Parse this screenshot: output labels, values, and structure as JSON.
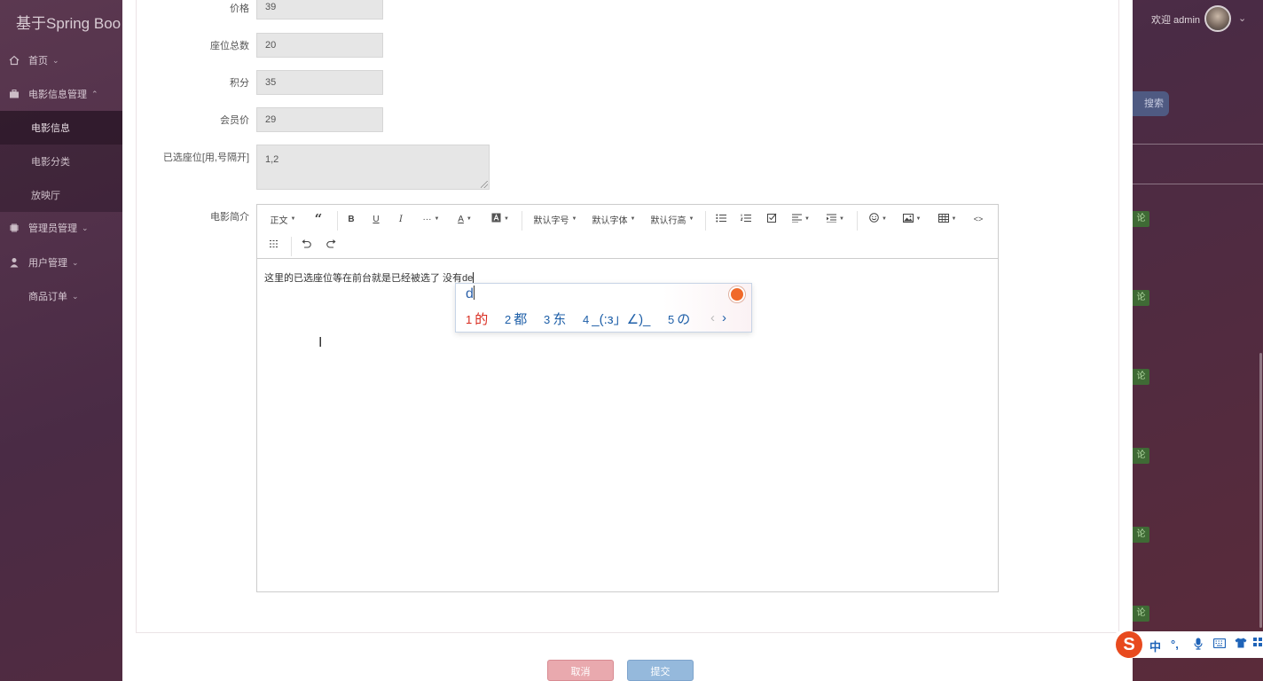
{
  "app": {
    "title": "基于Spring Boo",
    "welcome": "欢迎 admin",
    "user_chevron": "⌄"
  },
  "sidebar": {
    "items": [
      {
        "label": "首页",
        "icon": "home-icon"
      },
      {
        "label": "电影信息管理",
        "icon": "briefcase-icon"
      },
      {
        "label": "管理员管理",
        "icon": "chip-icon"
      },
      {
        "label": "用户管理",
        "icon": "user-icon"
      },
      {
        "label": "商品订单",
        "icon": ""
      }
    ],
    "subitems": [
      "电影信息",
      "电影分类",
      "放映厅"
    ],
    "active_subitem": "电影信息"
  },
  "background": {
    "search_label": "搜索",
    "badge_label": "论"
  },
  "form": {
    "fields": [
      {
        "label": "价格",
        "value": "39"
      },
      {
        "label": "座位总数",
        "value": "20"
      },
      {
        "label": "积分",
        "value": "35"
      },
      {
        "label": "会员价",
        "value": "29"
      }
    ],
    "seats": {
      "label": "已选座位[用,号隔开]",
      "value": "1,2"
    },
    "description": {
      "label": "电影简介",
      "text": "这里的已选座位等在前台就是已经被选了 没有de"
    }
  },
  "editor": {
    "toolbar": {
      "heading": "正文",
      "font_size": "默认字号",
      "font_family": "默认字体",
      "line_height": "默认行高",
      "more": "···",
      "bold": "B",
      "underline": "U",
      "italic": "I",
      "font_color": "A",
      "code": "<>"
    }
  },
  "ime": {
    "input": "d",
    "candidates": [
      {
        "n": "1",
        "text": "的"
      },
      {
        "n": "2",
        "text": "都"
      },
      {
        "n": "3",
        "text": "东"
      },
      {
        "n": "4",
        "text": "_(:з」∠)_"
      },
      {
        "n": "5",
        "text": "の"
      }
    ],
    "prev": "‹",
    "next": "›",
    "status": {
      "logo": "S",
      "mode": "中",
      "punct": "°,"
    }
  },
  "buttons": {
    "cancel": "取消",
    "submit": "提交"
  },
  "colors": {
    "ime_accent": "#1e5fa8",
    "ime_first": "#d82a1e",
    "cancel": "#e9a9ae",
    "submit": "#95b9dc",
    "badge_green": "#3f6a35"
  }
}
